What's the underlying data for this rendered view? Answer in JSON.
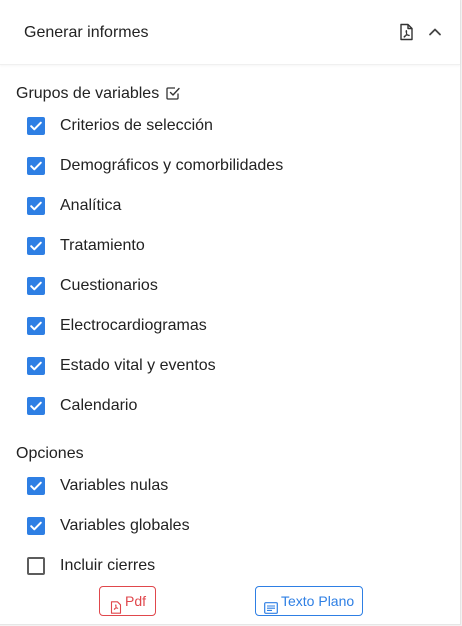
{
  "header": {
    "title": "Generar informes",
    "pdf_icon": "pdf-file-icon",
    "collapse_icon": "chevron-up-icon"
  },
  "groups": {
    "title": "Grupos de variables",
    "select_all_icon": "check-square-icon",
    "items": [
      {
        "label": "Criterios de selección",
        "checked": true
      },
      {
        "label": "Demográficos y comorbilidades",
        "checked": true
      },
      {
        "label": "Analítica",
        "checked": true
      },
      {
        "label": "Tratamiento",
        "checked": true
      },
      {
        "label": "Cuestionarios",
        "checked": true
      },
      {
        "label": "Electrocardiogramas",
        "checked": true
      },
      {
        "label": "Estado vital y eventos",
        "checked": true
      },
      {
        "label": "Calendario",
        "checked": true
      }
    ]
  },
  "options": {
    "title": "Opciones",
    "items": [
      {
        "label": "Variables nulas",
        "checked": true
      },
      {
        "label": "Variables globales",
        "checked": true
      },
      {
        "label": "Incluir cierres",
        "checked": false
      }
    ]
  },
  "actions": {
    "pdf_label": "Pdf",
    "text_label": "Texto Plano"
  },
  "colors": {
    "accent": "#2e7fe4",
    "pdf": "#e0474c"
  }
}
